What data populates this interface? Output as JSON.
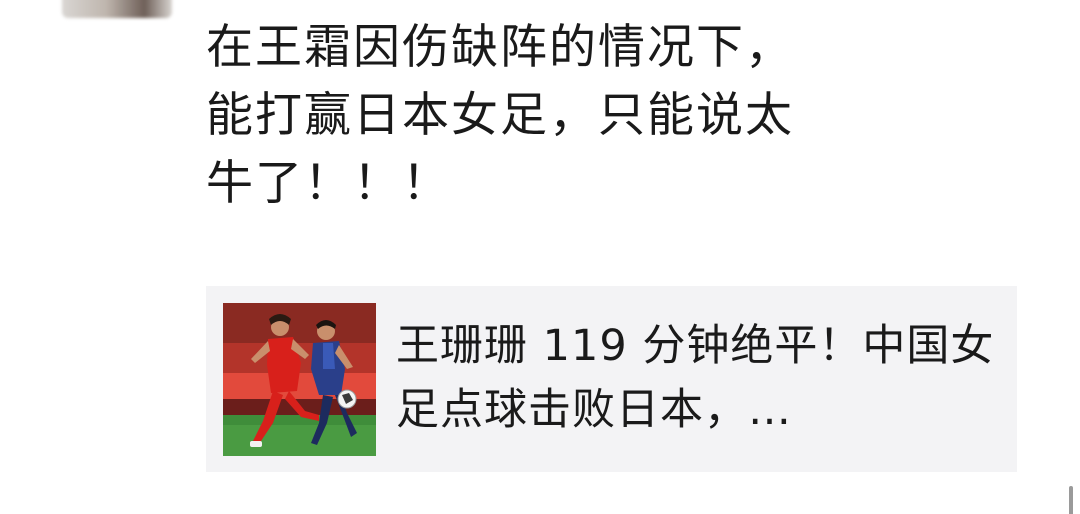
{
  "post": {
    "text": "在王霜因伤缺阵的情况下，\n能打赢日本女足，只能说太\n牛了！！！"
  },
  "link_card": {
    "title": "王珊珊 119 分钟绝平！中国女足点球击败日本，…",
    "thumbnail_icon": "football-match-thumbnail"
  }
}
